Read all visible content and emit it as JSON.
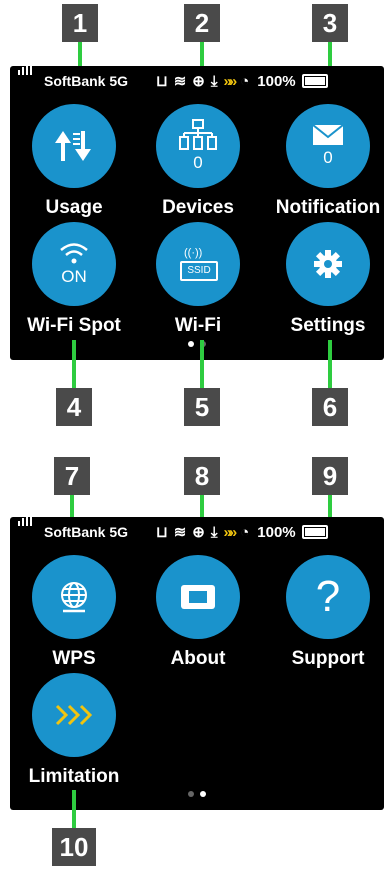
{
  "status": {
    "carrier": "SoftBank 5G",
    "battery": "100%"
  },
  "screen1": {
    "apps": [
      {
        "label": "Usage",
        "sub": ""
      },
      {
        "label": "Devices",
        "sub": "0"
      },
      {
        "label": "Notification",
        "sub": "0"
      },
      {
        "label": "Wi-Fi Spot",
        "sub": "ON"
      },
      {
        "label": "Wi-Fi",
        "sub": "SSID"
      },
      {
        "label": "Settings",
        "sub": ""
      }
    ],
    "page_indicator": {
      "current": 1,
      "total": 2
    }
  },
  "screen2": {
    "apps": [
      {
        "label": "WPS",
        "sub": ""
      },
      {
        "label": "About",
        "sub": ""
      },
      {
        "label": "Support",
        "sub": ""
      },
      {
        "label": "Limitation",
        "sub": ""
      }
    ],
    "page_indicator": {
      "current": 2,
      "total": 2
    }
  },
  "callouts": [
    "1",
    "2",
    "3",
    "4",
    "5",
    "6",
    "7",
    "8",
    "9",
    "10"
  ],
  "colors": {
    "icon_circle": "#1a93cc",
    "callout_bg": "#4a4a4a",
    "callout_line": "#2ecc40",
    "limitation_chevron": "#f1c40f"
  }
}
